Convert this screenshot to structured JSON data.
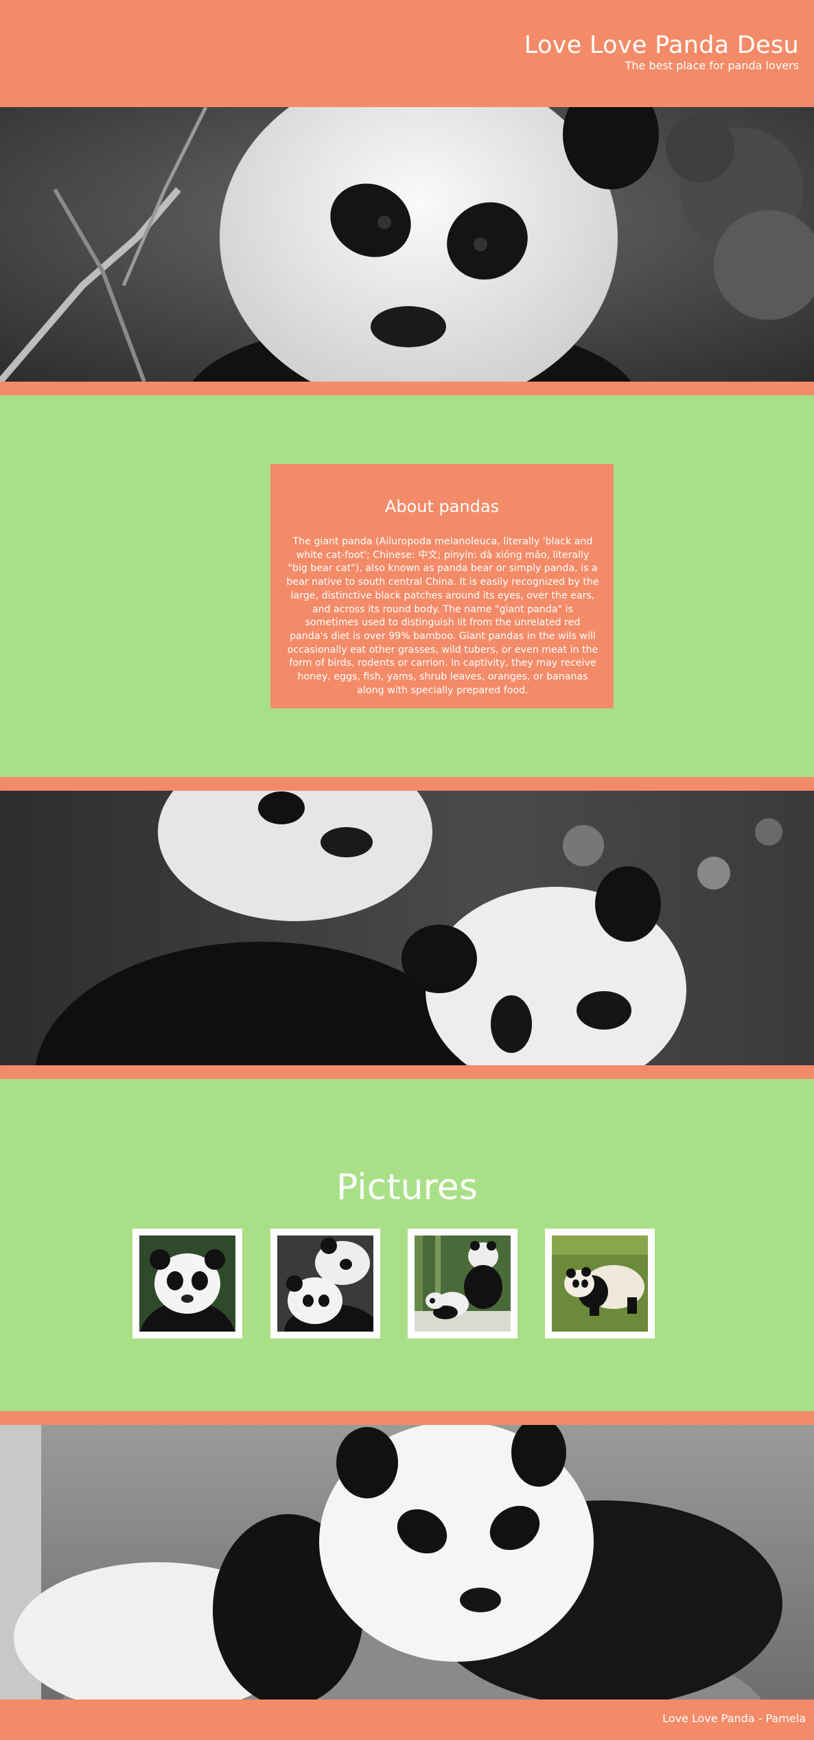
{
  "header": {
    "title": "Love Love Panda Desu",
    "subtitle": "The best place for panda lovers"
  },
  "about": {
    "title": "About pandas",
    "text": "The giant panda (Ailuropoda melanoleuca, literally 'black and white cat-foot'; Chinese: 中文; pinyin: dà xióng māo, literally \"big bear cat\"), also known as panda bear or simply panda, is a bear native to south central China. It is easily recognized by the large, distinctive black patches around its eyes, over the ears, and across its round body. The name \"giant panda\" is sometimes used to distinguish iit from the unrelated red panda's diet is over 99% bamboo. Giant pandas in the wils will occasionally eat other grasses, wild tubers, or even meat in the form of birds, rodents or carrion. In captivity, they may receive honey, eggs, fish, yams, shrub leaves, oranges, or bananas along with specially prepared food."
  },
  "pictures": {
    "title": "Pictures",
    "items": [
      {
        "icon": "panda-portrait-photo"
      },
      {
        "icon": "panda-pair-photo"
      },
      {
        "icon": "panda-family-photo"
      },
      {
        "icon": "panda-on-grass-photo"
      }
    ]
  },
  "banners": [
    {
      "icon": "panda-closeup-banner"
    },
    {
      "icon": "two-pandas-banner"
    },
    {
      "icon": "panda-resting-banner"
    }
  ],
  "footer": {
    "text": "Love Love Panda - Pamela"
  },
  "colors": {
    "accent": "#f38b68",
    "section_bg": "#a9e087",
    "text": "#ffffff"
  }
}
